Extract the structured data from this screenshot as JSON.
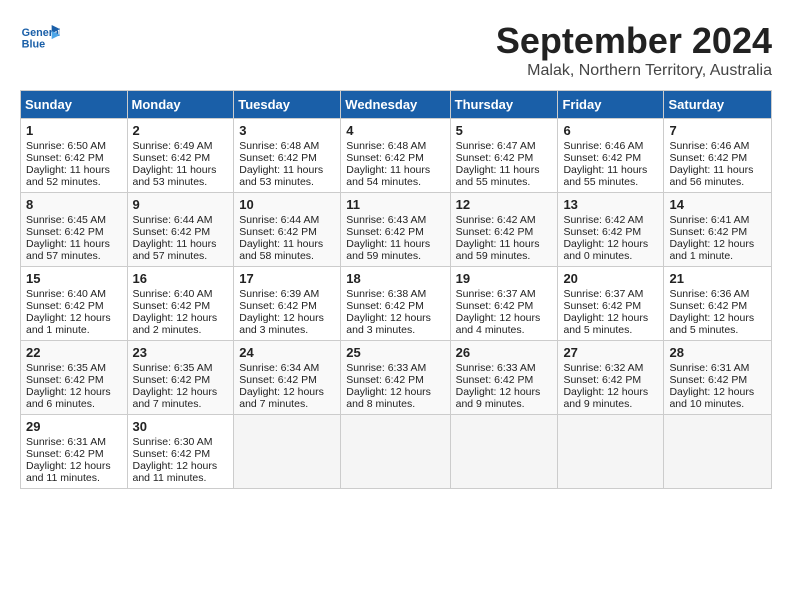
{
  "header": {
    "logo_text_general": "General",
    "logo_text_blue": "Blue",
    "month_title": "September 2024",
    "subtitle": "Malak, Northern Territory, Australia"
  },
  "weekdays": [
    "Sunday",
    "Monday",
    "Tuesday",
    "Wednesday",
    "Thursday",
    "Friday",
    "Saturday"
  ],
  "weeks": [
    [
      {
        "day": "1",
        "lines": [
          "Sunrise: 6:50 AM",
          "Sunset: 6:42 PM",
          "Daylight: 11 hours",
          "and 52 minutes."
        ]
      },
      {
        "day": "2",
        "lines": [
          "Sunrise: 6:49 AM",
          "Sunset: 6:42 PM",
          "Daylight: 11 hours",
          "and 53 minutes."
        ]
      },
      {
        "day": "3",
        "lines": [
          "Sunrise: 6:48 AM",
          "Sunset: 6:42 PM",
          "Daylight: 11 hours",
          "and 53 minutes."
        ]
      },
      {
        "day": "4",
        "lines": [
          "Sunrise: 6:48 AM",
          "Sunset: 6:42 PM",
          "Daylight: 11 hours",
          "and 54 minutes."
        ]
      },
      {
        "day": "5",
        "lines": [
          "Sunrise: 6:47 AM",
          "Sunset: 6:42 PM",
          "Daylight: 11 hours",
          "and 55 minutes."
        ]
      },
      {
        "day": "6",
        "lines": [
          "Sunrise: 6:46 AM",
          "Sunset: 6:42 PM",
          "Daylight: 11 hours",
          "and 55 minutes."
        ]
      },
      {
        "day": "7",
        "lines": [
          "Sunrise: 6:46 AM",
          "Sunset: 6:42 PM",
          "Daylight: 11 hours",
          "and 56 minutes."
        ]
      }
    ],
    [
      {
        "day": "8",
        "lines": [
          "Sunrise: 6:45 AM",
          "Sunset: 6:42 PM",
          "Daylight: 11 hours",
          "and 57 minutes."
        ]
      },
      {
        "day": "9",
        "lines": [
          "Sunrise: 6:44 AM",
          "Sunset: 6:42 PM",
          "Daylight: 11 hours",
          "and 57 minutes."
        ]
      },
      {
        "day": "10",
        "lines": [
          "Sunrise: 6:44 AM",
          "Sunset: 6:42 PM",
          "Daylight: 11 hours",
          "and 58 minutes."
        ]
      },
      {
        "day": "11",
        "lines": [
          "Sunrise: 6:43 AM",
          "Sunset: 6:42 PM",
          "Daylight: 11 hours",
          "and 59 minutes."
        ]
      },
      {
        "day": "12",
        "lines": [
          "Sunrise: 6:42 AM",
          "Sunset: 6:42 PM",
          "Daylight: 11 hours",
          "and 59 minutes."
        ]
      },
      {
        "day": "13",
        "lines": [
          "Sunrise: 6:42 AM",
          "Sunset: 6:42 PM",
          "Daylight: 12 hours",
          "and 0 minutes."
        ]
      },
      {
        "day": "14",
        "lines": [
          "Sunrise: 6:41 AM",
          "Sunset: 6:42 PM",
          "Daylight: 12 hours",
          "and 1 minute."
        ]
      }
    ],
    [
      {
        "day": "15",
        "lines": [
          "Sunrise: 6:40 AM",
          "Sunset: 6:42 PM",
          "Daylight: 12 hours",
          "and 1 minute."
        ]
      },
      {
        "day": "16",
        "lines": [
          "Sunrise: 6:40 AM",
          "Sunset: 6:42 PM",
          "Daylight: 12 hours",
          "and 2 minutes."
        ]
      },
      {
        "day": "17",
        "lines": [
          "Sunrise: 6:39 AM",
          "Sunset: 6:42 PM",
          "Daylight: 12 hours",
          "and 3 minutes."
        ]
      },
      {
        "day": "18",
        "lines": [
          "Sunrise: 6:38 AM",
          "Sunset: 6:42 PM",
          "Daylight: 12 hours",
          "and 3 minutes."
        ]
      },
      {
        "day": "19",
        "lines": [
          "Sunrise: 6:37 AM",
          "Sunset: 6:42 PM",
          "Daylight: 12 hours",
          "and 4 minutes."
        ]
      },
      {
        "day": "20",
        "lines": [
          "Sunrise: 6:37 AM",
          "Sunset: 6:42 PM",
          "Daylight: 12 hours",
          "and 5 minutes."
        ]
      },
      {
        "day": "21",
        "lines": [
          "Sunrise: 6:36 AM",
          "Sunset: 6:42 PM",
          "Daylight: 12 hours",
          "and 5 minutes."
        ]
      }
    ],
    [
      {
        "day": "22",
        "lines": [
          "Sunrise: 6:35 AM",
          "Sunset: 6:42 PM",
          "Daylight: 12 hours",
          "and 6 minutes."
        ]
      },
      {
        "day": "23",
        "lines": [
          "Sunrise: 6:35 AM",
          "Sunset: 6:42 PM",
          "Daylight: 12 hours",
          "and 7 minutes."
        ]
      },
      {
        "day": "24",
        "lines": [
          "Sunrise: 6:34 AM",
          "Sunset: 6:42 PM",
          "Daylight: 12 hours",
          "and 7 minutes."
        ]
      },
      {
        "day": "25",
        "lines": [
          "Sunrise: 6:33 AM",
          "Sunset: 6:42 PM",
          "Daylight: 12 hours",
          "and 8 minutes."
        ]
      },
      {
        "day": "26",
        "lines": [
          "Sunrise: 6:33 AM",
          "Sunset: 6:42 PM",
          "Daylight: 12 hours",
          "and 9 minutes."
        ]
      },
      {
        "day": "27",
        "lines": [
          "Sunrise: 6:32 AM",
          "Sunset: 6:42 PM",
          "Daylight: 12 hours",
          "and 9 minutes."
        ]
      },
      {
        "day": "28",
        "lines": [
          "Sunrise: 6:31 AM",
          "Sunset: 6:42 PM",
          "Daylight: 12 hours",
          "and 10 minutes."
        ]
      }
    ],
    [
      {
        "day": "29",
        "lines": [
          "Sunrise: 6:31 AM",
          "Sunset: 6:42 PM",
          "Daylight: 12 hours",
          "and 11 minutes."
        ]
      },
      {
        "day": "30",
        "lines": [
          "Sunrise: 6:30 AM",
          "Sunset: 6:42 PM",
          "Daylight: 12 hours",
          "and 11 minutes."
        ]
      },
      null,
      null,
      null,
      null,
      null
    ]
  ]
}
